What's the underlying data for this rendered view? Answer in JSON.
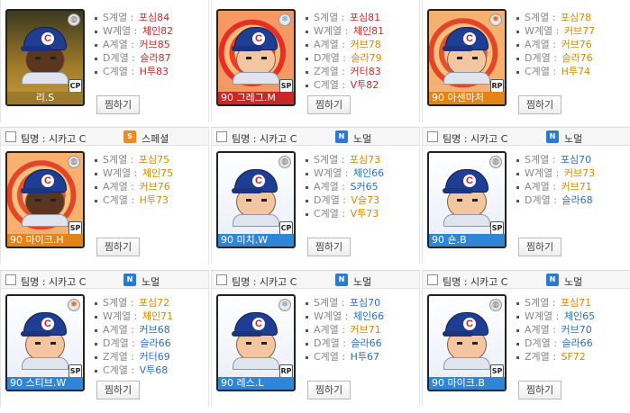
{
  "wish_label": "찜하기",
  "players": [
    {
      "team": "",
      "type_badge": "",
      "type_label": "",
      "card_style": "cp",
      "medal": "ball",
      "skin": "dark",
      "name": "리.S",
      "plate": "gold",
      "position": "CP",
      "stats": [
        {
          "label": "S계열 : ",
          "value": "포심84",
          "color": "red"
        },
        {
          "label": "W계열 : ",
          "value": "체인82",
          "color": "red"
        },
        {
          "label": "A계열 : ",
          "value": "커브85",
          "color": "red"
        },
        {
          "label": "D계열 : ",
          "value": "슬라87",
          "color": "red"
        },
        {
          "label": "C계열 : ",
          "value": "H투83",
          "color": "red"
        }
      ]
    },
    {
      "team": "",
      "type_badge": "",
      "type_label": "",
      "card_style": "fire",
      "medal": "snow",
      "skin": "light",
      "name": "90 그레그.M",
      "plate": "red",
      "position": "SP",
      "stats": [
        {
          "label": "S계열 : ",
          "value": "포심81",
          "color": "red"
        },
        {
          "label": "W계열 : ",
          "value": "체인81",
          "color": "red"
        },
        {
          "label": "A계열 : ",
          "value": "커브78",
          "color": "orange"
        },
        {
          "label": "D계열 : ",
          "value": "슬라79",
          "color": "orange"
        },
        {
          "label": "Z계열 : ",
          "value": "커터83",
          "color": "red"
        },
        {
          "label": "C계열 : ",
          "value": "V투82",
          "color": "red"
        }
      ]
    },
    {
      "team": "",
      "type_badge": "",
      "type_label": "",
      "card_style": "rp",
      "medal": "star",
      "skin": "light",
      "name": "90 아센마처",
      "plate": "orange",
      "position": "RP",
      "stats": [
        {
          "label": "S계열 : ",
          "value": "포심78",
          "color": "orange"
        },
        {
          "label": "W계열 : ",
          "value": "커브77",
          "color": "orange"
        },
        {
          "label": "A계열 : ",
          "value": "커브76",
          "color": "orange"
        },
        {
          "label": "D계열 : ",
          "value": "슬라76",
          "color": "orange"
        },
        {
          "label": "C계열 : ",
          "value": "H투74",
          "color": "orange"
        }
      ]
    },
    {
      "team": "팀명 : 시카고 C",
      "type_badge": "S",
      "type_label": "스페셜",
      "card_style": "rp",
      "medal": "ball",
      "skin": "dark",
      "name": "90 마이크.H",
      "plate": "orange",
      "position": "SP",
      "stats": [
        {
          "label": "S계열 : ",
          "value": "포심75",
          "color": "orange"
        },
        {
          "label": "W계열 : ",
          "value": "체인75",
          "color": "orange"
        },
        {
          "label": "A계열 : ",
          "value": "커브76",
          "color": "orange"
        },
        {
          "label": "C계열 : ",
          "value": "H투73",
          "color": "orange"
        }
      ]
    },
    {
      "team": "팀명 : 시카고 C",
      "type_badge": "N",
      "type_label": "노멀",
      "card_style": "sp",
      "medal": "ball",
      "skin": "light",
      "name": "90 미치.W",
      "plate": "blue",
      "position": "CP",
      "stats": [
        {
          "label": "S계열 : ",
          "value": "포심73",
          "color": "orange"
        },
        {
          "label": "W계열 : ",
          "value": "체인66",
          "color": "blue"
        },
        {
          "label": "A계열 : ",
          "value": "S커65",
          "color": "blue"
        },
        {
          "label": "D계열 : ",
          "value": "V슬73",
          "color": "orange"
        },
        {
          "label": "C계열 : ",
          "value": "V투73",
          "color": "orange"
        }
      ]
    },
    {
      "team": "팀명 : 시카고 C",
      "type_badge": "N",
      "type_label": "노멀",
      "card_style": "sp",
      "medal": "ball",
      "skin": "light",
      "name": "90 숀.B",
      "plate": "blue",
      "position": "SP",
      "stats": [
        {
          "label": "S계열 : ",
          "value": "포심70",
          "color": "blue"
        },
        {
          "label": "W계열 : ",
          "value": "커브73",
          "color": "orange"
        },
        {
          "label": "A계열 : ",
          "value": "커브71",
          "color": "orange"
        },
        {
          "label": "D계열 : ",
          "value": "슬라68",
          "color": "blue"
        }
      ]
    },
    {
      "team": "팀명 : 시카고 C",
      "type_badge": "N",
      "type_label": "노멀",
      "card_style": "sp",
      "medal": "star",
      "skin": "light",
      "name": "90 스티브.W",
      "plate": "blue",
      "position": "SP",
      "stats": [
        {
          "label": "S계열 : ",
          "value": "포심72",
          "color": "orange"
        },
        {
          "label": "W계열 : ",
          "value": "체인71",
          "color": "orange"
        },
        {
          "label": "A계열 : ",
          "value": "커브68",
          "color": "blue"
        },
        {
          "label": "D계열 : ",
          "value": "슬라66",
          "color": "blue"
        },
        {
          "label": "Z계열 : ",
          "value": "커터69",
          "color": "blue"
        },
        {
          "label": "C계열 : ",
          "value": "V투68",
          "color": "blue"
        }
      ]
    },
    {
      "team": "팀명 : 시카고 C",
      "type_badge": "N",
      "type_label": "노멀",
      "card_style": "sp",
      "medal": "snow",
      "skin": "light",
      "name": "90 레스.L",
      "plate": "blue",
      "position": "RP",
      "stats": [
        {
          "label": "S계열 : ",
          "value": "포심70",
          "color": "blue"
        },
        {
          "label": "W계열 : ",
          "value": "체인66",
          "color": "blue"
        },
        {
          "label": "A계열 : ",
          "value": "커브71",
          "color": "orange"
        },
        {
          "label": "D계열 : ",
          "value": "슬라66",
          "color": "blue"
        },
        {
          "label": "C계열 : ",
          "value": "H투67",
          "color": "blue"
        }
      ]
    },
    {
      "team": "팀명 : 시카고 C",
      "type_badge": "N",
      "type_label": "노멀",
      "card_style": "sp",
      "medal": "ball",
      "skin": "light",
      "name": "90 마이크.B",
      "plate": "blue",
      "position": "SP",
      "stats": [
        {
          "label": "S계열 : ",
          "value": "포심71",
          "color": "orange"
        },
        {
          "label": "W계열 : ",
          "value": "체인65",
          "color": "blue"
        },
        {
          "label": "A계열 : ",
          "value": "커브70",
          "color": "blue"
        },
        {
          "label": "D계열 : ",
          "value": "슬라66",
          "color": "blue"
        },
        {
          "label": "Z계열 : ",
          "value": "SF72",
          "color": "orange"
        }
      ]
    }
  ]
}
